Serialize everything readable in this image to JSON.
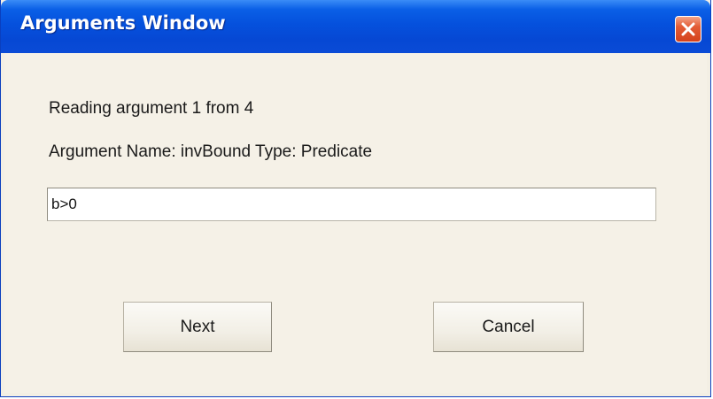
{
  "window": {
    "title": "Arguments Window",
    "close_icon": "close-icon"
  },
  "content": {
    "reading_line": "Reading argument 1 from 4",
    "argument_line": "Argument Name: invBound Type: Predicate",
    "input_value": "b>0"
  },
  "buttons": {
    "next_label": "Next",
    "cancel_label": "Cancel"
  },
  "colors": {
    "titlebar": "#0551dd",
    "close_button": "#e35c36",
    "background": "#f5f1e7"
  }
}
